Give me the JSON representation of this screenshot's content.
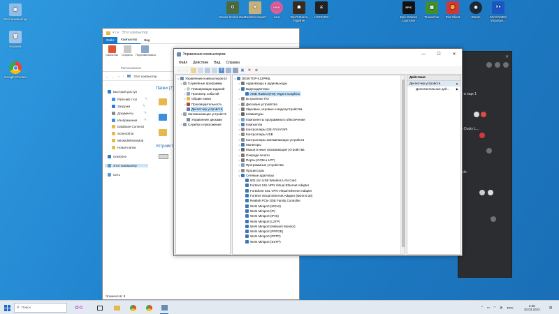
{
  "desktop_icons": [
    {
      "label": "Этот компьютер",
      "glyph": "▣",
      "color": "#8fbde8"
    },
    {
      "label": "Корзина",
      "glyph": "🗑",
      "color": "#9fc3e6"
    },
    {
      "label": "Google Chrome",
      "glyph": "●",
      "color": "#e9423a"
    }
  ],
  "top_icons": [
    {
      "label": "Goose Goose Duck",
      "glyph": "G",
      "color": "#4c6b3c"
    },
    {
      "label": "Genshin Impact",
      "glyph": "✦",
      "color": "#c8b07a"
    },
    {
      "label": "osu!",
      "glyph": "osu!",
      "color": "#e05a9c"
    },
    {
      "label": "Don't Starve Together",
      "glyph": "☗",
      "color": "#3a2b20"
    },
    {
      "label": "LOSTARK",
      "glyph": "⚔",
      "color": "#222"
    },
    {
      "label": "Epic Games Launcher",
      "glyph": "EPIC",
      "color": "#111"
    },
    {
      "label": "TLauncher",
      "glyph": "▦",
      "color": "#3f8f2e"
    },
    {
      "label": "Riot Client",
      "glyph": "✊",
      "color": "#d13639"
    },
    {
      "label": "Steam",
      "glyph": "◉",
      "color": "#1b2838"
    },
    {
      "label": "MY.GAMES Игровой...",
      "glyph": "✕●",
      "color": "#1a56c4"
    }
  ],
  "dark_window": {
    "rows": [
      {
        "text": "е в еще 1"
      },
      {
        "text": "h Dusty L..."
      },
      {
        "text": "iele"
      }
    ]
  },
  "explorer": {
    "title": "Этот компьютер",
    "tabs": [
      "Файл",
      "Компьютер",
      "Вид"
    ],
    "ribbon_buttons": [
      "Свойства",
      "Открыть",
      "Переименовать"
    ],
    "ribbon_group": "Расположение",
    "address": "Этот компьютер",
    "right_heading": "Папки (7)",
    "right_heading_2": "Устройства",
    "nav_items": [
      {
        "label": "Быстрый доступ",
        "color": "#2a7fd4"
      },
      {
        "label": "Рабочий стол",
        "color": "#3e8fd9"
      },
      {
        "label": "Загрузки",
        "color": "#2a7fd4"
      },
      {
        "label": "Документы",
        "color": "#888"
      },
      {
        "label": "Изображения",
        "color": "#3e8fd9"
      },
      {
        "label": "Database Connecti",
        "color": "#e8b84a"
      },
      {
        "label": "ScreenShot",
        "color": "#e8b84a"
      },
      {
        "label": "WickedWhimsMod",
        "color": "#e8b84a"
      },
      {
        "label": "Новая папка",
        "color": "#e8b84a"
      },
      {
        "label": "OneDrive",
        "color": "#2a7fd4"
      },
      {
        "label": "Этот компьютер",
        "color": "#5a9bd8"
      },
      {
        "label": "Сеть",
        "color": "#5a9bd8"
      }
    ],
    "status": "Элементов: 8"
  },
  "mmc": {
    "title": "Управление компьютером",
    "menu": [
      "Файл",
      "Действие",
      "Вид",
      "Справка"
    ],
    "left_tree": [
      {
        "label": "Управление компьютером (л",
        "level": 0,
        "exp": "v"
      },
      {
        "label": "Служебные программы",
        "level": 1,
        "exp": "v"
      },
      {
        "label": "Планировщик заданий",
        "level": 2,
        "exp": ">"
      },
      {
        "label": "Просмотр событий",
        "level": 2,
        "exp": ">"
      },
      {
        "label": "Общие папки",
        "level": 2,
        "exp": ">"
      },
      {
        "label": "Производительность",
        "level": 2,
        "exp": ">"
      },
      {
        "label": "Диспетчер устройств",
        "level": 2,
        "exp": "",
        "selected": true
      },
      {
        "label": "Запоминающие устройств",
        "level": 1,
        "exp": "v"
      },
      {
        "label": "Управление дисками",
        "level": 2,
        "exp": ""
      },
      {
        "label": "Службы и приложения",
        "level": 1,
        "exp": ">"
      }
    ],
    "device_tree": [
      {
        "label": "DESKTOP-412PR6L",
        "level": 0,
        "exp": "v",
        "color": "#4f7fb5"
      },
      {
        "label": "Аудиовходы и аудиовыходы",
        "level": 1,
        "exp": ">",
        "color": "#777"
      },
      {
        "label": "Видеоадаптеры",
        "level": 1,
        "exp": "v",
        "color": "#3a78b5"
      },
      {
        "label": "AMD Radeon(TM) Vega 6 Graphics",
        "level": 2,
        "exp": "",
        "color": "#3a78b5",
        "selected": true
      },
      {
        "label": "Встроенное ПО",
        "level": 1,
        "exp": ">",
        "color": "#888"
      },
      {
        "label": "Дисковые устройства",
        "level": 1,
        "exp": ">",
        "color": "#888"
      },
      {
        "label": "Звуковые, игровые и видеоустройства",
        "level": 1,
        "exp": ">",
        "color": "#777"
      },
      {
        "label": "Клавиатуры",
        "level": 1,
        "exp": ">",
        "color": "#666"
      },
      {
        "label": "Компоненты программного обеспечения",
        "level": 1,
        "exp": ">",
        "color": "#7a9cc4"
      },
      {
        "label": "Компьютер",
        "level": 1,
        "exp": ">",
        "color": "#4f7fb5"
      },
      {
        "label": "Контроллеры IDE ATA/ATAPI",
        "level": 1,
        "exp": ">",
        "color": "#888"
      },
      {
        "label": "Контроллеры USB",
        "level": 1,
        "exp": ">",
        "color": "#888"
      },
      {
        "label": "Контроллеры запоминающих устройств",
        "level": 1,
        "exp": ">",
        "color": "#888"
      },
      {
        "label": "Мониторы",
        "level": 1,
        "exp": ">",
        "color": "#3a78b5"
      },
      {
        "label": "Мыши и иные указывающие устройства",
        "level": 1,
        "exp": ">",
        "color": "#666"
      },
      {
        "label": "Очереди печати",
        "level": 1,
        "exp": ">",
        "color": "#777"
      },
      {
        "label": "Порты (COM и LPT)",
        "level": 1,
        "exp": ">",
        "color": "#777"
      },
      {
        "label": "Программные устройства",
        "level": 1,
        "exp": ">",
        "color": "#7a9cc4"
      },
      {
        "label": "Процессоры",
        "level": 1,
        "exp": ">",
        "color": "#888"
      },
      {
        "label": "Сетевые адаптеры",
        "level": 1,
        "exp": "v",
        "color": "#3a78b5"
      },
      {
        "label": "802.11n USB Wireless LAN Card",
        "level": 2,
        "exp": "",
        "color": "#3a78b5"
      },
      {
        "label": "Fortinet SSL VPN Virtual Ethernet Adapter",
        "level": 2,
        "exp": "",
        "color": "#3a78b5"
      },
      {
        "label": "Forticlient SSL VPN Virtual Ethernet Adapter",
        "level": 2,
        "exp": "",
        "color": "#3a78b5"
      },
      {
        "label": "Fortinet Virtual Ethernet Adapter (NDIS 6.30)",
        "level": 2,
        "exp": "",
        "color": "#3a78b5"
      },
      {
        "label": "Realtek PCIe GbE Family Controller",
        "level": 2,
        "exp": "",
        "color": "#3a78b5"
      },
      {
        "label": "WAN Miniport (IKEv2)",
        "level": 2,
        "exp": "",
        "color": "#3a78b5"
      },
      {
        "label": "WAN Miniport (IP)",
        "level": 2,
        "exp": "",
        "color": "#3a78b5"
      },
      {
        "label": "WAN Miniport (IPv6)",
        "level": 2,
        "exp": "",
        "color": "#3a78b5"
      },
      {
        "label": "WAN Miniport (L2TP)",
        "level": 2,
        "exp": "",
        "color": "#3a78b5"
      },
      {
        "label": "WAN Miniport (Network Monitor)",
        "level": 2,
        "exp": "",
        "color": "#3a78b5"
      },
      {
        "label": "WAN Miniport (PPPOE)",
        "level": 2,
        "exp": "",
        "color": "#3a78b5"
      },
      {
        "label": "WAN Miniport (PPTP)",
        "level": 2,
        "exp": "",
        "color": "#3a78b5"
      },
      {
        "label": "WAN Miniport (SSTP)",
        "level": 2,
        "exp": "",
        "color": "#3a78b5"
      }
    ],
    "actions": {
      "header": "Действия",
      "section": "Диспетчер устройств",
      "item": "Дополнительные дей..."
    }
  },
  "taskbar": {
    "search_placeholder": "Поиск",
    "language": "РУС",
    "time": "2:58",
    "date": "20.03.2023"
  }
}
